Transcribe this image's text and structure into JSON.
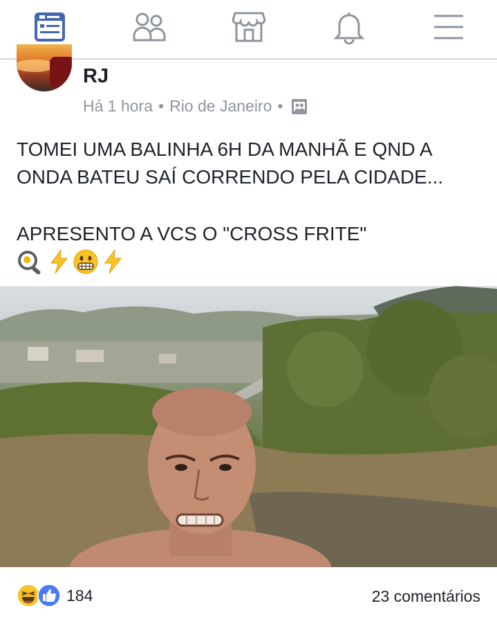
{
  "nav": {
    "items": [
      {
        "name": "news-feed-icon",
        "active": true
      },
      {
        "name": "friends-icon",
        "active": false
      },
      {
        "name": "marketplace-icon",
        "active": false
      },
      {
        "name": "notifications-icon",
        "active": false
      },
      {
        "name": "menu-icon",
        "active": false
      }
    ],
    "active_color": "#4267b2",
    "inactive_color": "#8d949e"
  },
  "post": {
    "author": "RJ",
    "time": "Há 1 hora",
    "location": "Rio de Janeiro",
    "privacy_icon": "public-photo-icon",
    "text_line1": "TOMEI UMA BALINHA 6H DA MANHÃ E QND A",
    "text_line2": "ONDA BATEU SAÍ CORRENDO PELA CIDADE...",
    "text_line3": "APRESENTO A VCS O \"CROSS FRITE\"",
    "emojis": [
      "fried-egg-icon",
      "lightning-icon",
      "grimacing-face-icon",
      "lightning-icon"
    ]
  },
  "footer": {
    "reaction_icons": [
      "haha-reaction-icon",
      "like-reaction-icon"
    ],
    "reaction_count": "184",
    "comments": "23 comentários"
  }
}
